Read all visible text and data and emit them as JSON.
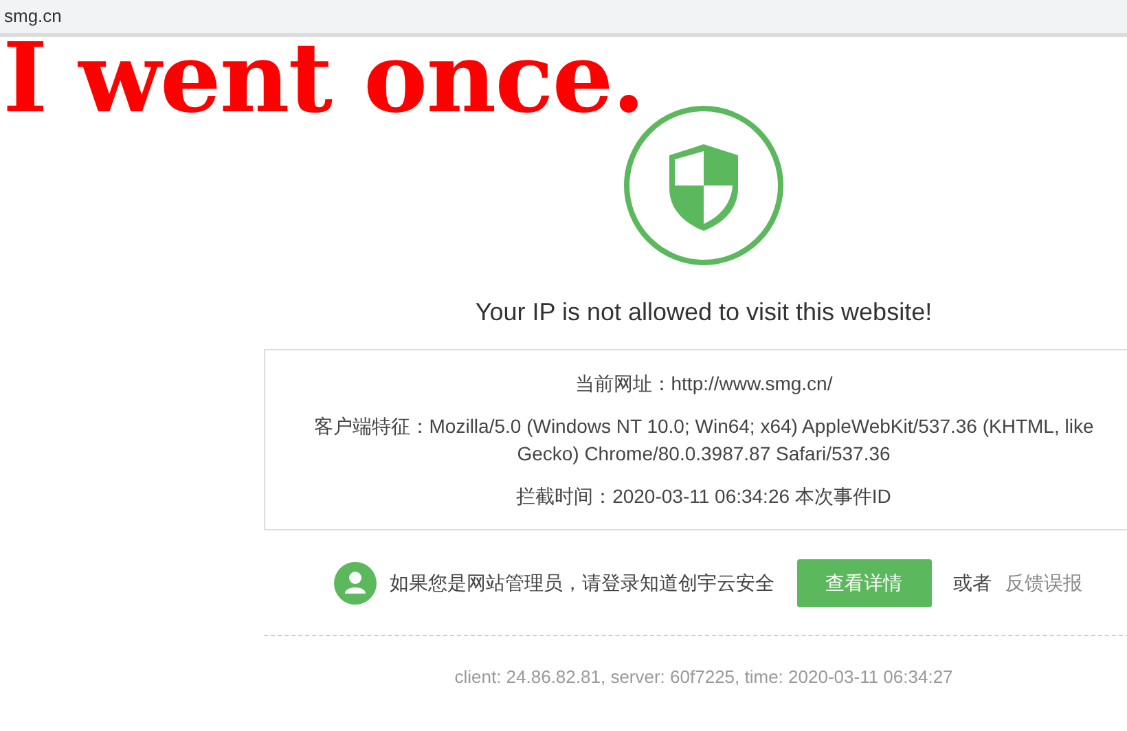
{
  "tab": {
    "title": "smg.cn"
  },
  "caption": "I went once.",
  "page": {
    "heading": "Your IP is not allowed to visit this website!",
    "info": [
      {
        "label": "当前网址：",
        "value": "http://www.smg.cn/"
      },
      {
        "label": "客户端特征：",
        "value": "Mozilla/5.0 (Windows NT 10.0; Win64; x64) AppleWebKit/537.36 (KHTML, like Gecko) Chrome/80.0.3987.87 Safari/537.36"
      },
      {
        "label": "拦截时间：",
        "value": "2020-03-11 06:34:26  本次事件ID"
      }
    ],
    "admin_text": "如果您是网站管理员，请登录知道创宇云安全",
    "details_button": "查看详情",
    "or_text": "或者",
    "report_link": "反馈误报",
    "footer": "client: 24.86.82.81, server: 60f7225, time: 2020-03-11 06:34:27"
  }
}
